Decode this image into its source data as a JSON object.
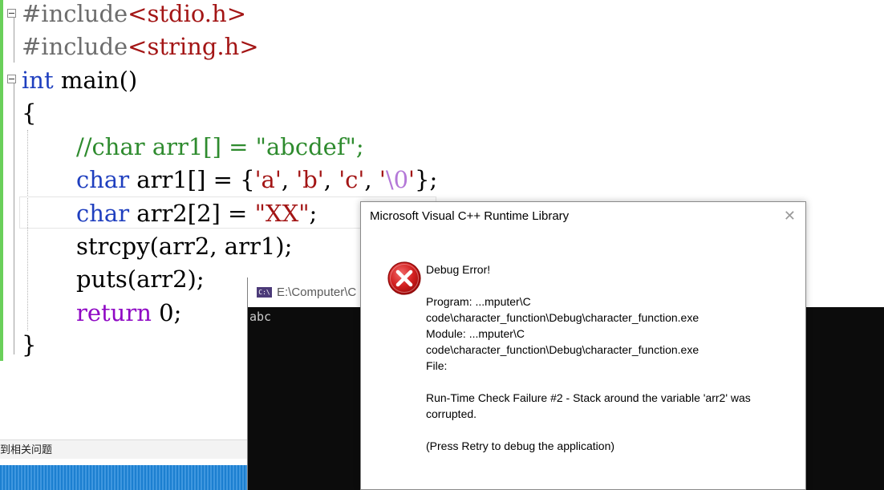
{
  "editor": {
    "code": {
      "l1_hash": "#include",
      "l1_header": "<stdio.h>",
      "l2_hash": "#include",
      "l2_header": "<string.h>",
      "l3_type": "int",
      "l3_rest": " main()",
      "l4": "{",
      "l5_comment": "//char arr1[] = \"abcdef\";",
      "l6_type": "char",
      "l6_a": " arr1[] = {",
      "l6_c1": "'a'",
      "l6_sep1": ", ",
      "l6_c2": "'b'",
      "l6_sep2": ", ",
      "l6_c3": "'c'",
      "l6_sep3": ", ",
      "l6_q1": "'",
      "l6_esc": "\\0",
      "l6_q2": "'",
      "l6_end": "};",
      "l7_type": "char",
      "l7_a": " arr2[2] = ",
      "l7_str": "\"XX\"",
      "l7_end": ";",
      "l8": "strcpy(arr2, arr1);",
      "l9": "puts(arr2);",
      "l10_kw": "return",
      "l10_rest": " 0;",
      "l11": "}"
    }
  },
  "bottom_panel": {
    "tab_label": "到相关问题"
  },
  "console": {
    "icon_text": "C:\\",
    "title": "E:\\Computer\\C",
    "output": "abc"
  },
  "dialog": {
    "title": "Microsoft Visual C++ Runtime Library",
    "close_glyph": "✕",
    "icon": "error-icon",
    "lines": [
      "Debug Error!",
      "",
      "Program: ...mputer\\C",
      "code\\character_function\\Debug\\character_function.exe",
      "Module: ...mputer\\C",
      "code\\character_function\\Debug\\character_function.exe",
      "File:",
      "",
      "Run-Time Check Failure #2 - Stack around the variable 'arr2' was",
      "corrupted.",
      "",
      "(Press Retry to debug the application)"
    ]
  },
  "colors": {
    "keyword": "#1f3fbf",
    "string": "#a31515",
    "comment": "#2e8b2e",
    "return_keyword": "#8f08c4",
    "escape": "#b478d8",
    "change_bar": "#6ad05a"
  }
}
